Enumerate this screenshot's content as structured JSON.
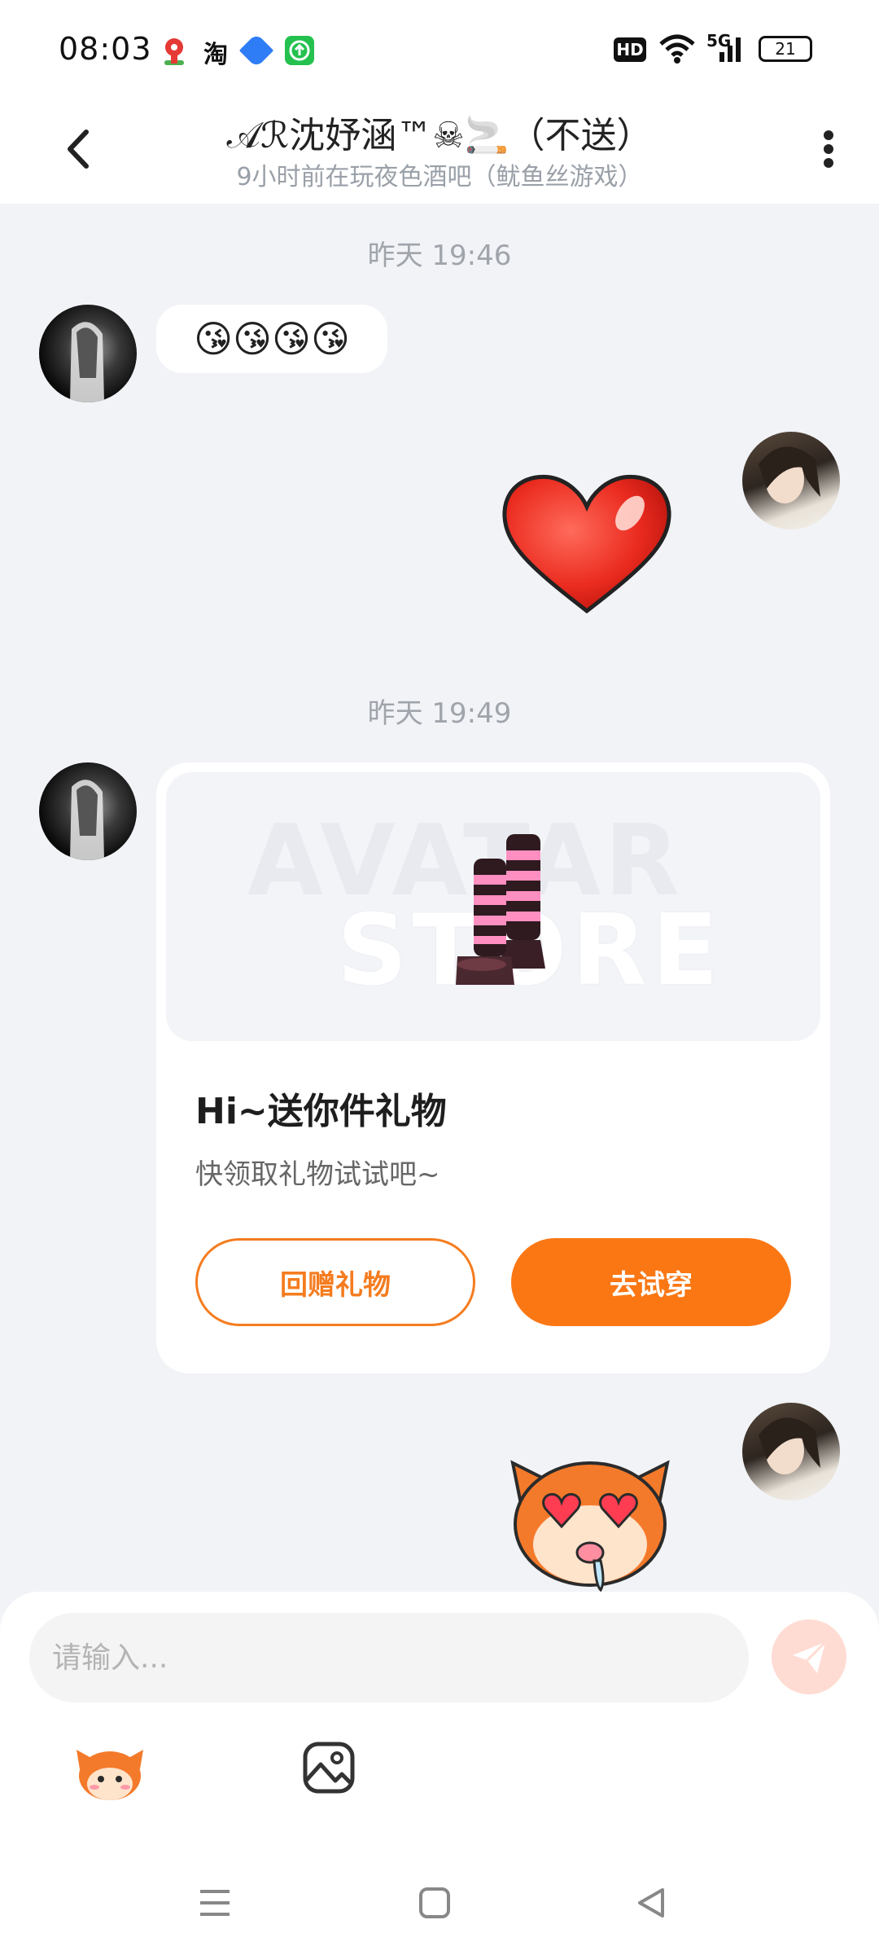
{
  "status_bar": {
    "time": "08:03",
    "network": "5G",
    "battery": "21",
    "hd_label": "HD",
    "taobao_label": "淘",
    "icons": [
      "map-pin-icon",
      "taobao-icon",
      "blue-app-icon",
      "green-upload-icon",
      "hd-icon",
      "wifi-icon",
      "signal-icon",
      "battery-icon"
    ]
  },
  "header": {
    "title": "𝒜ℛ沈妤涵™☠🚬（不送）",
    "subtitle": "9小时前在玩夜色酒吧（鱿鱼丝游戏）",
    "back_icon": "chevron-left-icon",
    "more_icon": "more-vertical-icon"
  },
  "messages": {
    "timestamp_1": "昨天 19:46",
    "emoji_text": "😘😘😘😘",
    "timestamp_2": "昨天 19:49",
    "watermark_line1": "AVATAR",
    "watermark_line2": "STORE"
  },
  "gift_card": {
    "title": "Hi~送你件礼物",
    "description": "快领取礼物试试吧~",
    "return_button": "回赠礼物",
    "try_button": "去试穿"
  },
  "input": {
    "placeholder": "请输入...",
    "send_icon": "paper-plane-icon",
    "toolbar_icons": [
      "mascot-sticker-icon",
      "image-icon"
    ]
  },
  "colors": {
    "accent": "#fb7714",
    "background": "#f1f3f7",
    "send_button": "#ffdcd3"
  },
  "nav": {
    "icons": [
      "menu-icon",
      "home-square-icon",
      "back-triangle-icon"
    ]
  }
}
